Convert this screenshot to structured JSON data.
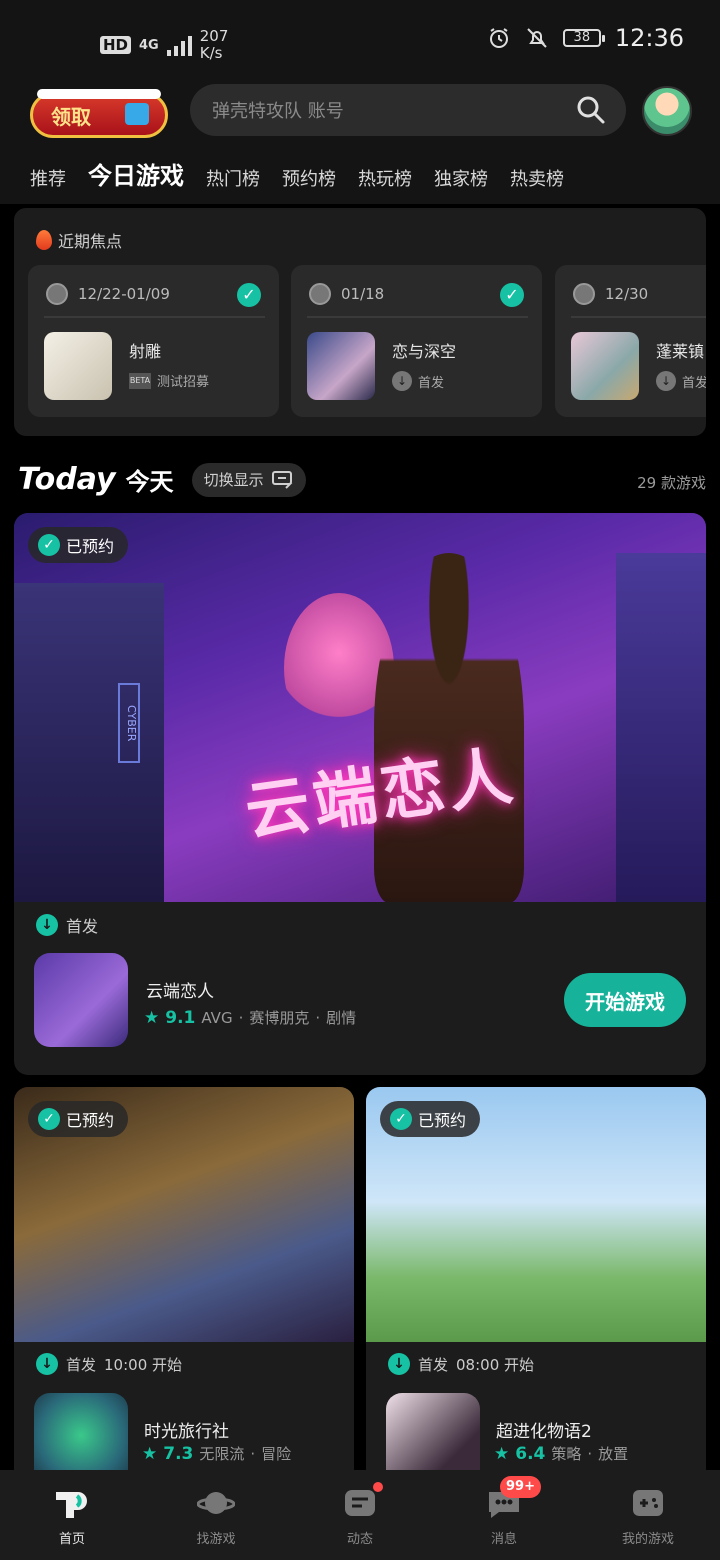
{
  "status_bar": {
    "network_hd": "HD",
    "network_type": "4G",
    "speed_value": "207",
    "speed_unit": "K/s",
    "battery": "38",
    "time": "12:36"
  },
  "header": {
    "gift_label": "领取",
    "search_placeholder": "弹壳特攻队 账号"
  },
  "tabs": [
    "推荐",
    "今日游戏",
    "热门榜",
    "预约榜",
    "热玩榜",
    "独家榜",
    "热卖榜"
  ],
  "focus": {
    "title": "近期焦点",
    "cards": [
      {
        "date": "12/22-01/09",
        "name": "射雕",
        "tag": "测试招募",
        "tag_icon": "beta-icon",
        "checked": true
      },
      {
        "date": "01/18",
        "name": "恋与深空",
        "tag": "首发",
        "tag_icon": "download-icon",
        "checked": true
      },
      {
        "date": "12/30",
        "name": "蓬莱镇",
        "tag": "首发",
        "tag_icon": "download-icon",
        "checked": false
      }
    ]
  },
  "today": {
    "title_en": "Today",
    "title_cn": "今天",
    "switch_label": "切换显示",
    "count": "29 款游戏"
  },
  "featured": {
    "badge": "已预约",
    "banner_title": "云端恋人",
    "banner_sign": "CYBER",
    "release_label": "首发",
    "name": "云端恋人",
    "score": "9.1",
    "tags": [
      "AVG",
      "赛博朋克",
      "剧情"
    ],
    "play_button": "开始游戏"
  },
  "cards": [
    {
      "badge": "已预约",
      "release": "首发",
      "time": "10:00 开始",
      "name": "时光旅行社",
      "score": "7.3",
      "tags": [
        "无限流",
        "冒险"
      ]
    },
    {
      "badge": "已预约",
      "release": "首发",
      "time": "08:00 开始",
      "name": "超进化物语2",
      "score": "6.4",
      "tags": [
        "策略",
        "放置"
      ]
    }
  ],
  "bottom_nav": [
    {
      "label": "首页",
      "icon": "home-icon"
    },
    {
      "label": "找游戏",
      "icon": "planet-icon"
    },
    {
      "label": "动态",
      "icon": "feed-icon"
    },
    {
      "label": "消息",
      "icon": "message-icon",
      "badge": "99+"
    },
    {
      "label": "我的游戏",
      "icon": "gamepad-icon"
    }
  ],
  "colors": {
    "accent": "#16c2a3",
    "background": "#000000",
    "card": "#1c1c1c",
    "badge_red": "#ff4a4a"
  }
}
